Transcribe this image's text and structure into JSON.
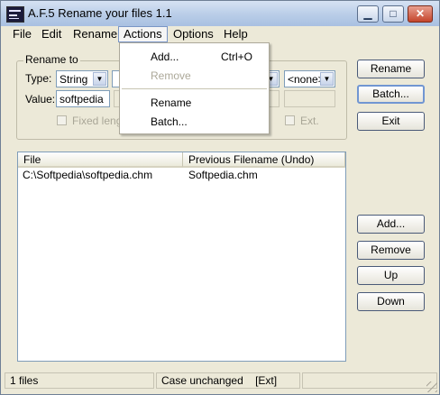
{
  "window": {
    "title": "A.F.5 Rename your files 1.1"
  },
  "menu": [
    "File",
    "Edit",
    "Rename",
    "Actions",
    "Options",
    "Help"
  ],
  "actions_menu": {
    "items": [
      {
        "label": "Add...",
        "shortcut": "Ctrl+O",
        "enabled": true
      },
      {
        "label": "Remove",
        "enabled": false
      },
      {
        "label": "Rename",
        "enabled": true
      },
      {
        "label": "Batch...",
        "enabled": true
      }
    ]
  },
  "rename_to": {
    "group_label": "Rename to",
    "type_label": "Type:",
    "type_value": "String",
    "value_label": "Value:",
    "value": "softpedia",
    "case_value": "<none>",
    "fixed_length_label": "Fixed lengt",
    "ext_label": "Ext."
  },
  "buttons": {
    "rename": "Rename",
    "batch": "Batch...",
    "exit": "Exit",
    "add": "Add...",
    "remove": "Remove",
    "up": "Up",
    "down": "Down"
  },
  "file_list": {
    "columns": [
      "File",
      "Previous Filename (Undo)"
    ],
    "rows": [
      {
        "file": "C:\\Softpedia\\softpedia.chm",
        "previous": "Softpedia.chm"
      }
    ]
  },
  "status": {
    "files": "1 files",
    "case": "Case unchanged",
    "ext": "[Ext]"
  },
  "colors": {
    "window_bg": "#ece9d8",
    "titlebar": "#b9cde8",
    "close_button": "#c4452c"
  }
}
